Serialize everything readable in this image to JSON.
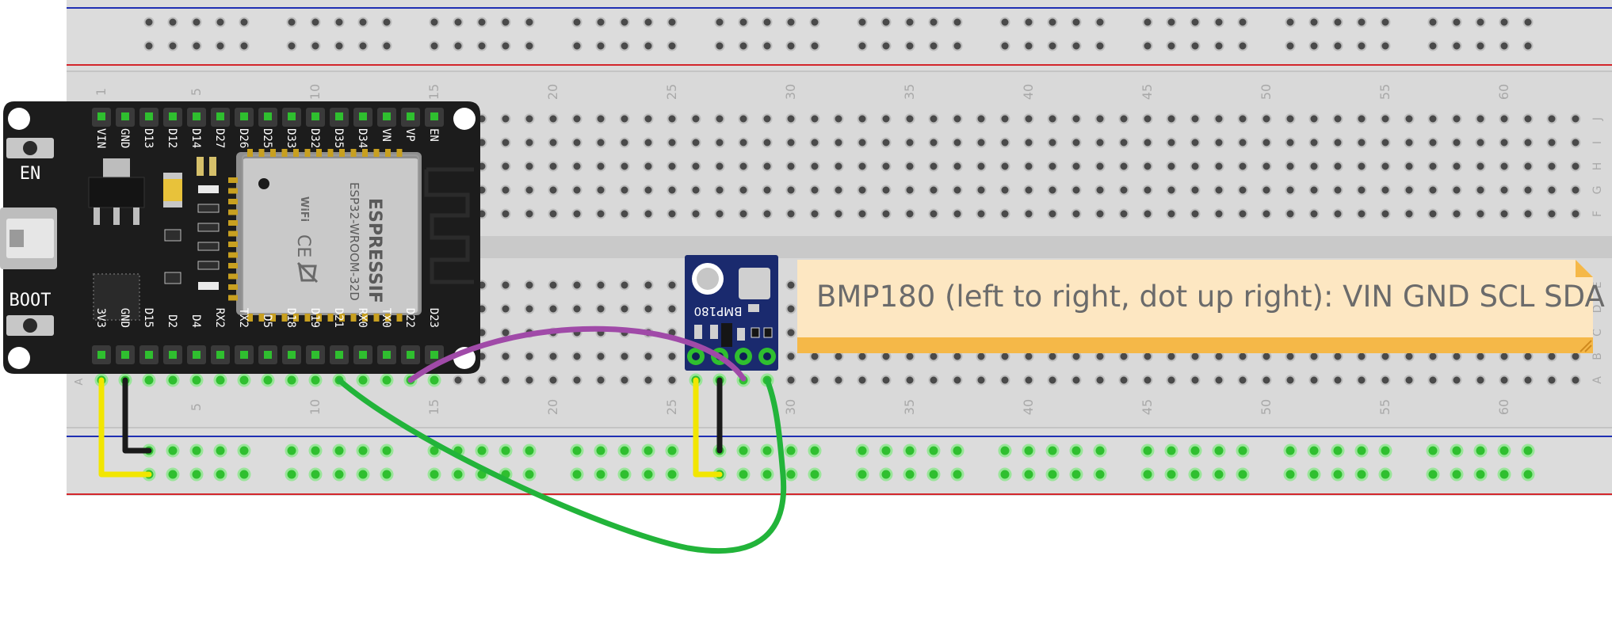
{
  "breadboard": {
    "column_numbers": [
      "1",
      "5",
      "10",
      "15",
      "20",
      "25",
      "30",
      "35",
      "40",
      "45",
      "50",
      "55",
      "60"
    ],
    "column_values": [
      1,
      5,
      10,
      15,
      20,
      25,
      30,
      35,
      40,
      45,
      50,
      55,
      60
    ],
    "row_letters_top": [
      "J",
      "I",
      "H",
      "G",
      "F"
    ],
    "row_letters_bottom": [
      "E",
      "D",
      "C",
      "B",
      "A"
    ],
    "left_row_letter_bottom": "A",
    "rail_colors": {
      "positive": "#d3262b",
      "negative": "#1f2fb3"
    }
  },
  "esp32": {
    "top_pins": [
      "VIN",
      "GND",
      "D13",
      "D12",
      "D14",
      "D27",
      "D26",
      "D25",
      "D33",
      "D32",
      "D35",
      "D34",
      "VN",
      "VP",
      "EN"
    ],
    "bottom_pins": [
      "3V3",
      "GND",
      "D15",
      "D2",
      "D4",
      "RX2",
      "TX2",
      "D5",
      "D18",
      "D19",
      "D21",
      "RX0",
      "TX0",
      "D22",
      "D23"
    ],
    "en_button_label": "EN",
    "boot_button_label": "BOOT",
    "module_brand": "ESPRESSIF",
    "module_model": "ESP32-WROOM-32D",
    "wifi_mark": "WiFi",
    "ce_mark": "CE"
  },
  "bmp180": {
    "label": "BMP180"
  },
  "note": {
    "text": "BMP180 (left to right, dot up right): VIN GND SCL SDA"
  },
  "wires": [
    {
      "color_name": "yellow",
      "color": "#f2e600"
    },
    {
      "color_name": "black",
      "color": "#1a1a1a"
    },
    {
      "color_name": "green",
      "color": "#22b43a"
    },
    {
      "color_name": "purple",
      "color": "#a04aa8"
    }
  ]
}
